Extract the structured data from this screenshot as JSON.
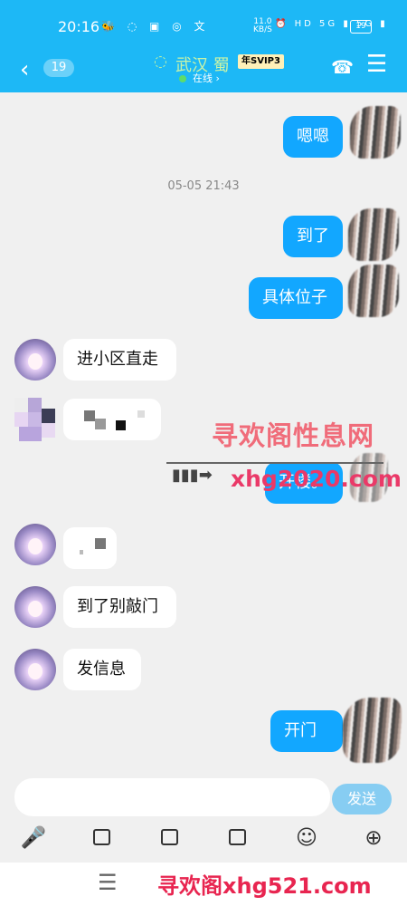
{
  "status_bar": {
    "time": "20:16",
    "network_speed": "11.0\nKB/S",
    "battery": "19",
    "app_icons": "🐝 ◌ ▣ ◎ 文",
    "network_icons": "⏰ HD 5G ▮ 5G ▮"
  },
  "header": {
    "unread_count": "19",
    "contact_name": "武汉 蜀",
    "badge": "年SVIP3",
    "status": "在线 ›"
  },
  "timestamp": "05-05 21:43",
  "messages": {
    "m1": "嗯嗯",
    "m2": "到了",
    "m3": "具体位子",
    "m4": "进小区直走",
    "m5": "开楼。",
    "m6": "到了别敲门",
    "m7": "发信息",
    "m8": "开门"
  },
  "watermark": {
    "title": "寻欢阁性息网",
    "site": "xhg2020.com",
    "footer": "寻欢阁xhg521.com"
  },
  "input": {
    "send_label": "发送"
  },
  "colors": {
    "accent": "#1db8f6",
    "bubble": "#12a7ff",
    "watermark": "#ea3968"
  }
}
